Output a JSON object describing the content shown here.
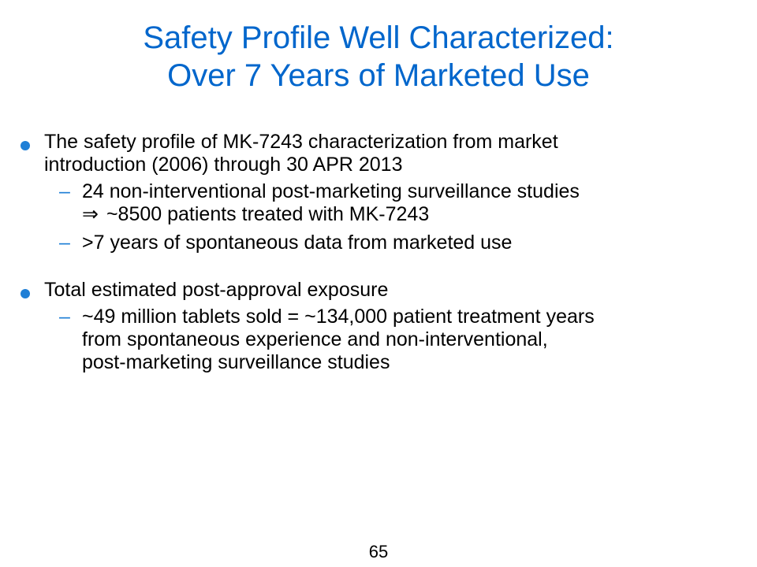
{
  "slide": {
    "title_line1": "Safety Profile Well Characterized:",
    "title_line2": "Over 7 Years of Marketed Use",
    "accent_color": "#0066cc",
    "bullet_color": "#1f7fd6",
    "page_number": "65"
  },
  "bullets": [
    {
      "text_line1": "The safety profile of MK-7243 characterization from market",
      "text_line2": "introduction (2006) through 30 APR 2013",
      "sub": [
        {
          "dash": "–",
          "text_line1": "24 non-interventional post-marketing surveillance studies",
          "arrow": "⇒",
          "text_line2": "~8500 patients treated with MK-7243"
        },
        {
          "dash": "–",
          "text_line1": ">7 years of spontaneous data from marketed use"
        }
      ]
    },
    {
      "text_line1": "Total estimated post-approval exposure",
      "sub": [
        {
          "dash": "–",
          "text_line1": "~49 million tablets sold = ~134,000 patient treatment years",
          "text_line2": "from spontaneous experience and non-interventional,",
          "text_line3": "post-marketing surveillance studies"
        }
      ]
    }
  ]
}
